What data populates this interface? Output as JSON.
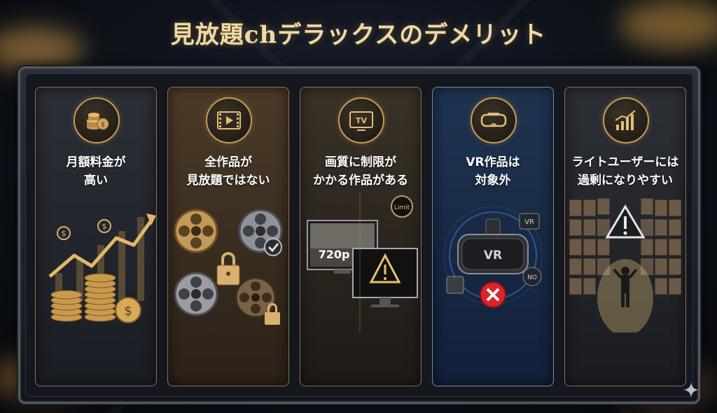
{
  "title": "見放題chデラックスのデメリット",
  "panels": [
    {
      "line1": "月額料金が",
      "line2": "高い",
      "icon": "coins-icon"
    },
    {
      "line1": "全作品が",
      "line2": "見放題ではない",
      "icon": "film-icon"
    },
    {
      "line1": "画質に制限が",
      "line2": "かかる作品がある",
      "icon": "tv-icon",
      "tv_label": "TV",
      "resolution": "720p",
      "limit_label": "Limit"
    },
    {
      "line1": "VR作品は",
      "line2": "対象外",
      "icon": "vr-headset-icon",
      "vr_label": "VR",
      "vr_badge": "VR",
      "no_badge": "NO"
    },
    {
      "line1": "ライトユーザーには",
      "line2": "過剰になりやすい",
      "icon": "growth-chart-icon"
    }
  ],
  "colors": {
    "gold": "#c69b57",
    "title": "#efd9a6",
    "warning": "#e8c070",
    "error": "#d8262b"
  }
}
